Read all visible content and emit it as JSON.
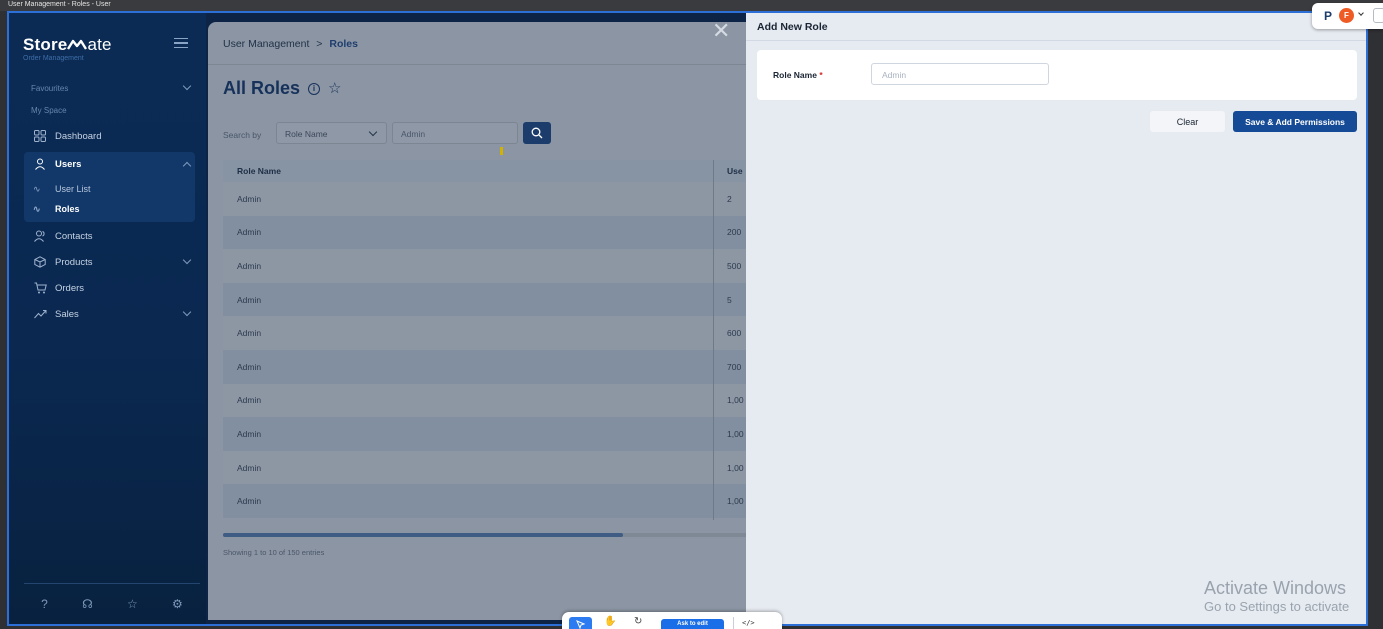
{
  "window_title": "User Management - Roles - User",
  "sidebar": {
    "logo_bold": "Store",
    "logo_light": "ate",
    "logo_subtitle": "Order Management",
    "favourites_label": "Favourites",
    "myspace_label": "My Space",
    "items": [
      {
        "label": "Dashboard",
        "icon": "grid-icon"
      },
      {
        "label": "Users",
        "icon": "user-icon"
      },
      {
        "label": "Contacts",
        "icon": "contacts-icon"
      },
      {
        "label": "Products",
        "icon": "box-icon"
      },
      {
        "label": "Orders",
        "icon": "cart-icon"
      },
      {
        "label": "Sales",
        "icon": "trend-icon"
      }
    ],
    "submenu": [
      {
        "label": "User List"
      },
      {
        "label": "Roles"
      }
    ]
  },
  "main": {
    "breadcrumb_parent": "User Management",
    "breadcrumb_sep": ">",
    "breadcrumb_current": "Roles",
    "page_title": "All Roles",
    "search_by_label": "Search by",
    "search_field_selected": "Role Name",
    "search_value": "Admin",
    "table": {
      "columns": [
        "Role Name",
        "Use"
      ],
      "rows": [
        [
          "Admin",
          "2"
        ],
        [
          "Admin",
          "200"
        ],
        [
          "Admin",
          "500"
        ],
        [
          "Admin",
          "5"
        ],
        [
          "Admin",
          "600"
        ],
        [
          "Admin",
          "700"
        ],
        [
          "Admin",
          "1,00"
        ],
        [
          "Admin",
          "1,00"
        ],
        [
          "Admin",
          "1,00"
        ],
        [
          "Admin",
          "1,00"
        ]
      ]
    },
    "showing_text": "Showing 1 to 10 of 150 entries"
  },
  "drawer": {
    "title": "Add New Role",
    "role_name_label": "Role Name",
    "required_mark": "*",
    "role_name_placeholder": "Admin",
    "clear_label": "Clear",
    "save_label": "Save & Add Permissions"
  },
  "watermark": {
    "line1": "Activate Windows",
    "line2": "Go to Settings to activate"
  },
  "extension": {
    "p_label": "P",
    "f_label": "F"
  },
  "bottom_toolbar": {
    "ask_label": "Ask to edit",
    "code_label": "</>"
  },
  "colors": {
    "accent": "#154b96",
    "sidebar_bg": "#0b2b55",
    "drawer_bg": "#e6ebf1",
    "required": "#d42b2b"
  }
}
